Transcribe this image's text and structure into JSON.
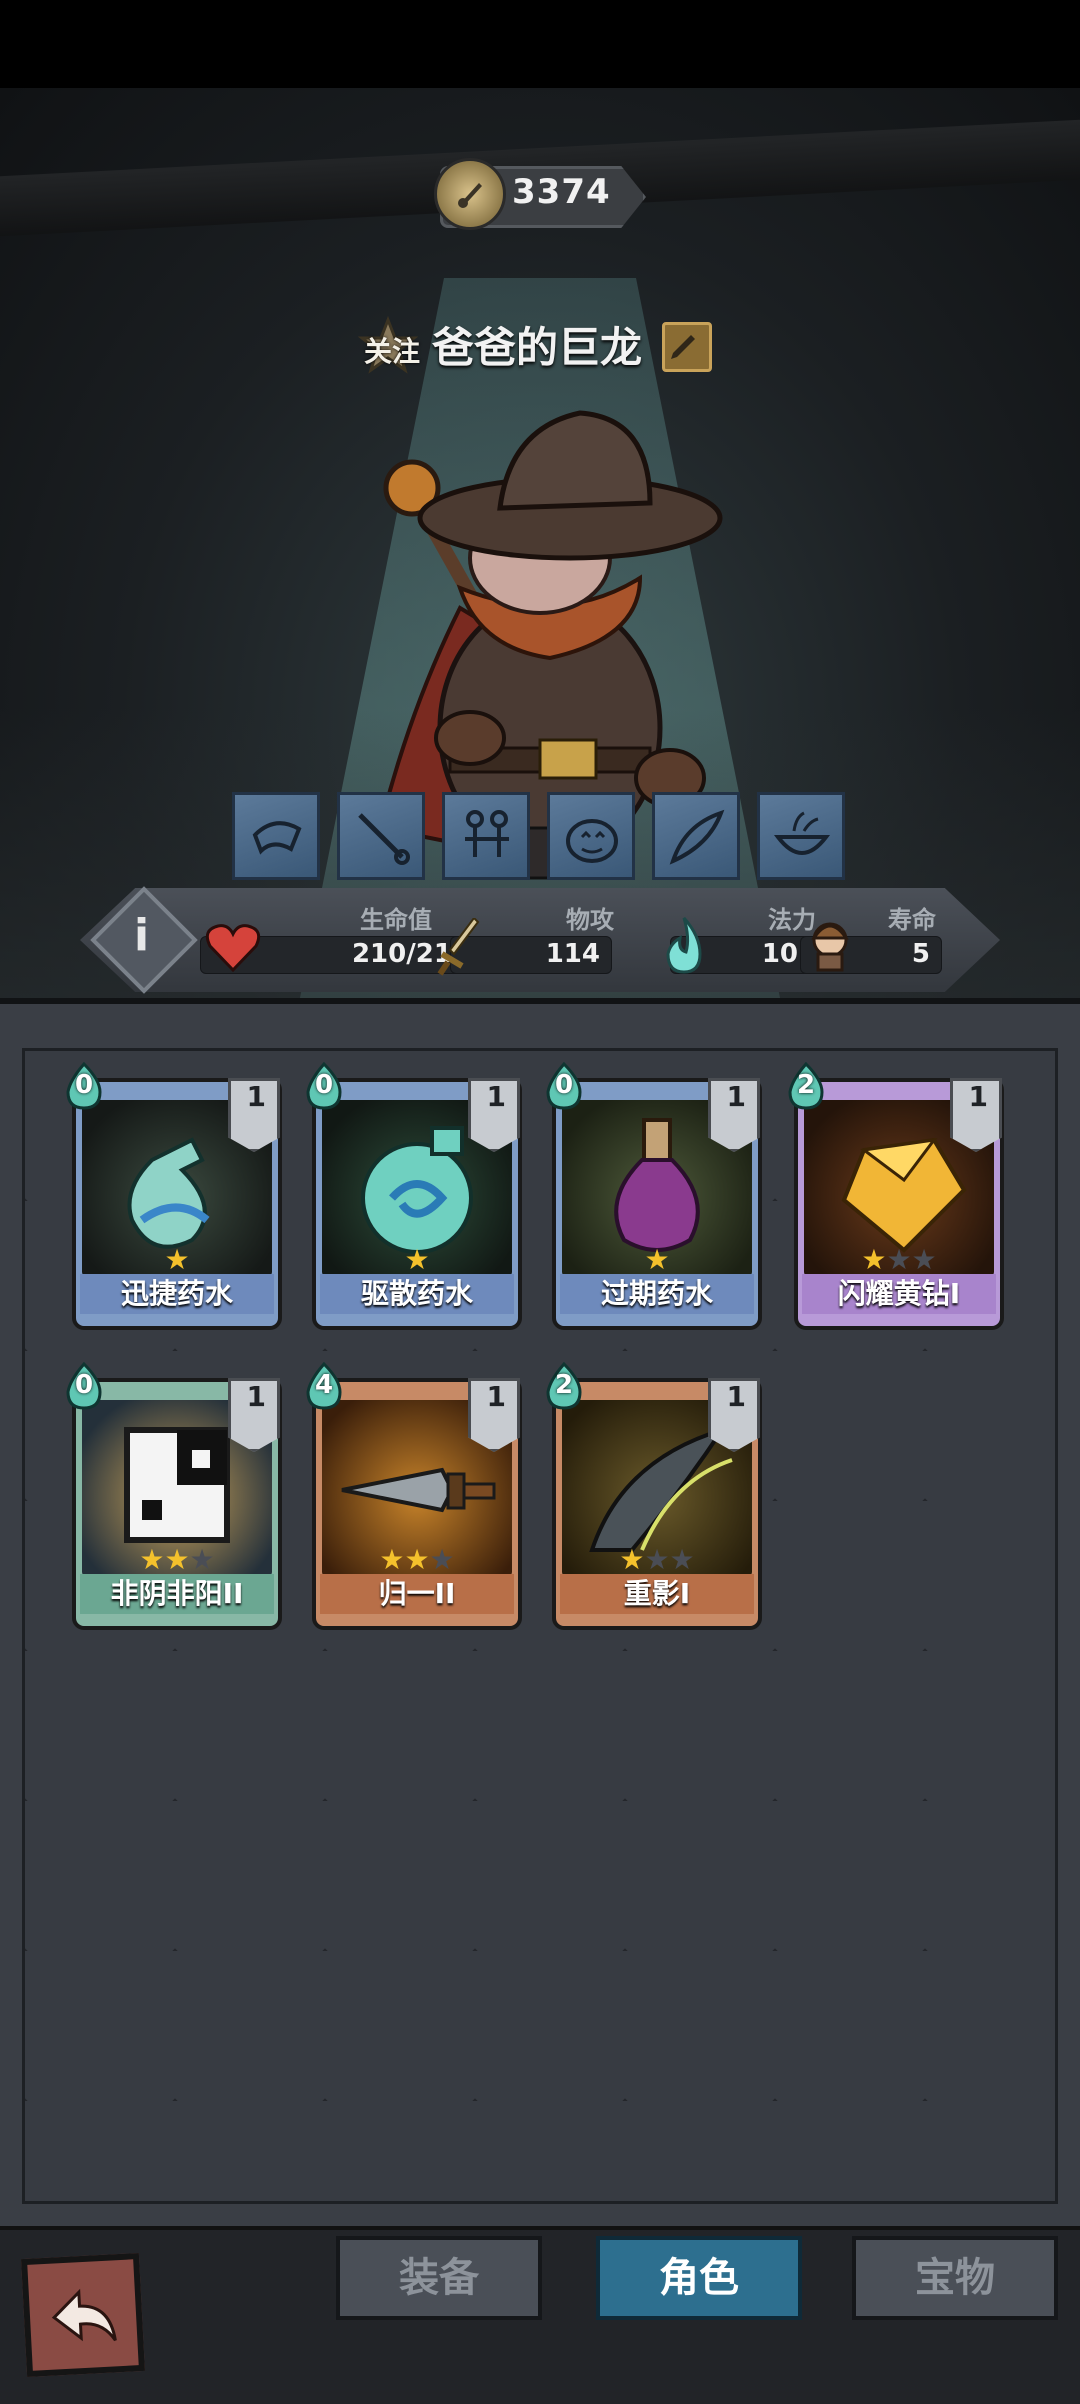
{
  "header": {
    "power": "3374",
    "follow_label": "关注",
    "hero_name": "爸爸的巨龙"
  },
  "skills": [
    "weapon-scroll-icon",
    "sword-icon",
    "figures-icon",
    "pumpkin-icon",
    "feather-icon",
    "bowl-icon"
  ],
  "stats": {
    "hp": {
      "label": "生命值",
      "value": "210/210"
    },
    "attack": {
      "label": "物攻",
      "value": "114"
    },
    "mana": {
      "label": "法力",
      "value": "10"
    },
    "lifespan": {
      "label": "寿命",
      "value": "5"
    }
  },
  "cards": [
    {
      "name": "迅捷药水",
      "cost": "0",
      "level": "1",
      "stars": 1,
      "max_stars": 1,
      "rarity": "blue"
    },
    {
      "name": "驱散药水",
      "cost": "0",
      "level": "1",
      "stars": 1,
      "max_stars": 1,
      "rarity": "blue"
    },
    {
      "name": "过期药水",
      "cost": "0",
      "level": "1",
      "stars": 1,
      "max_stars": 1,
      "rarity": "blue"
    },
    {
      "name": "闪耀黄钻I",
      "cost": "2",
      "level": "1",
      "stars": 1,
      "max_stars": 3,
      "rarity": "purple"
    },
    {
      "name": "非阴非阳II",
      "cost": "0",
      "level": "1",
      "stars": 2,
      "max_stars": 3,
      "rarity": "teal"
    },
    {
      "name": "归一II",
      "cost": "4",
      "level": "1",
      "stars": 2,
      "max_stars": 3,
      "rarity": "orange"
    },
    {
      "name": "重影I",
      "cost": "2",
      "level": "1",
      "stars": 1,
      "max_stars": 3,
      "rarity": "orange"
    }
  ],
  "nav": {
    "equip": "装备",
    "role": "角色",
    "treasure": "宝物"
  },
  "colors": {
    "blue_card": "#7f9cc6",
    "purple_card": "#b89ad8",
    "teal_card": "#88b8a6",
    "orange_card": "#c78a66",
    "star": "#f4c12c",
    "active_tab": "#5aa7c7"
  }
}
